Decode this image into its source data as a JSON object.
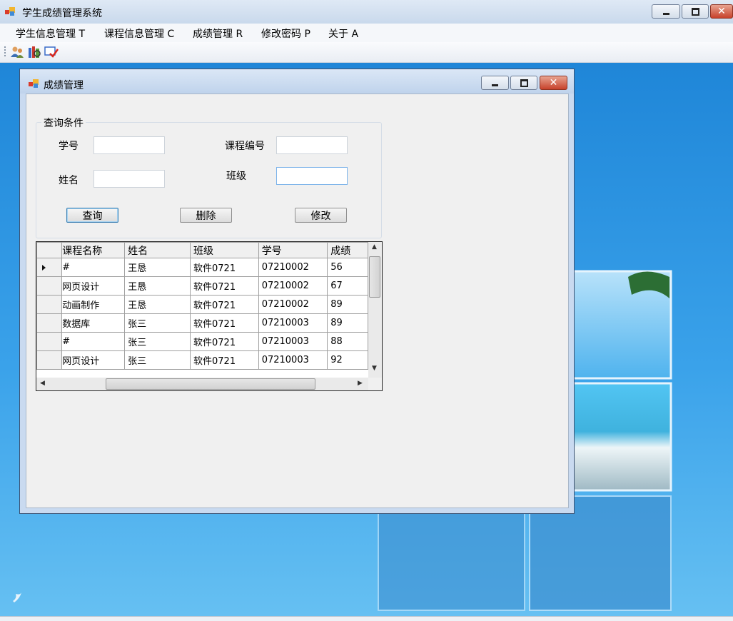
{
  "app": {
    "title": "学生成绩管理系统"
  },
  "menu": {
    "items": [
      {
        "label": "学生信息管理 T"
      },
      {
        "label": "课程信息管理 C"
      },
      {
        "label": "成绩管理 R"
      },
      {
        "label": "修改密码 P"
      },
      {
        "label": "关于 A"
      }
    ]
  },
  "toolbar": {
    "icons": [
      "users-icon",
      "books-icon",
      "grade-check-icon"
    ]
  },
  "child": {
    "title": "成绩管理",
    "group_title": "查询条件",
    "fields": {
      "student_id_label": "学号",
      "student_id_value": "",
      "name_label": "姓名",
      "name_value": "",
      "course_id_label": "课程编号",
      "course_id_value": "",
      "class_label": "班级",
      "class_value": ""
    },
    "buttons": {
      "query": "查询",
      "delete": "删除",
      "modify": "修改"
    },
    "grid": {
      "columns": [
        "课程名称",
        "姓名",
        "班级",
        "学号",
        "成绩"
      ],
      "visible_headers": [
        "课程名称",
        "姓名",
        "班级",
        "学号",
        "成绩"
      ],
      "rows": [
        [
          "#",
          "王恳",
          "软件0721",
          "07210002",
          "56"
        ],
        [
          "网页设计",
          "王恳",
          "软件0721",
          "07210002",
          "67"
        ],
        [
          "动画制作",
          "王恳",
          "软件0721",
          "07210002",
          "89"
        ],
        [
          "数据库",
          "张三",
          "软件0721",
          "07210003",
          "89"
        ],
        [
          "#",
          "张三",
          "软件0721",
          "07210003",
          "88"
        ],
        [
          "网页设计",
          "张三",
          "软件0721",
          "07210003",
          "92"
        ]
      ],
      "selected_row": 0
    }
  },
  "colors": {
    "desktop_top": "#1f86d8",
    "desktop_bottom": "#66c0f2",
    "close_red": "#c7422b"
  }
}
